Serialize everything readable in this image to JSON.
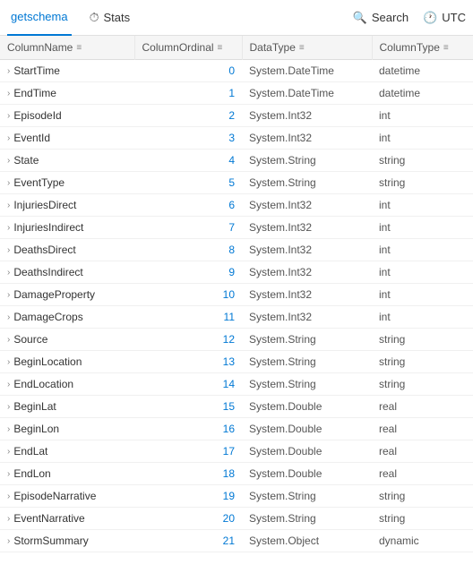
{
  "topbar": {
    "tab_getschema": "getschema",
    "tab_stats": "Stats",
    "search_label": "Search",
    "utc_label": "UTC"
  },
  "table": {
    "headers": [
      {
        "id": "col-name",
        "label": "ColumnName",
        "icon": "≡"
      },
      {
        "id": "col-ordinal",
        "label": "ColumnOrdinal",
        "icon": "≡"
      },
      {
        "id": "col-datatype",
        "label": "DataType",
        "icon": "≡"
      },
      {
        "id": "col-type",
        "label": "ColumnType",
        "icon": "≡"
      }
    ],
    "rows": [
      {
        "name": "StartTime",
        "ordinal": "0",
        "datatype": "System.DateTime",
        "coltype": "datetime"
      },
      {
        "name": "EndTime",
        "ordinal": "1",
        "datatype": "System.DateTime",
        "coltype": "datetime"
      },
      {
        "name": "EpisodeId",
        "ordinal": "2",
        "datatype": "System.Int32",
        "coltype": "int"
      },
      {
        "name": "EventId",
        "ordinal": "3",
        "datatype": "System.Int32",
        "coltype": "int"
      },
      {
        "name": "State",
        "ordinal": "4",
        "datatype": "System.String",
        "coltype": "string"
      },
      {
        "name": "EventType",
        "ordinal": "5",
        "datatype": "System.String",
        "coltype": "string"
      },
      {
        "name": "InjuriesDirect",
        "ordinal": "6",
        "datatype": "System.Int32",
        "coltype": "int"
      },
      {
        "name": "InjuriesIndirect",
        "ordinal": "7",
        "datatype": "System.Int32",
        "coltype": "int"
      },
      {
        "name": "DeathsDirect",
        "ordinal": "8",
        "datatype": "System.Int32",
        "coltype": "int"
      },
      {
        "name": "DeathsIndirect",
        "ordinal": "9",
        "datatype": "System.Int32",
        "coltype": "int"
      },
      {
        "name": "DamageProperty",
        "ordinal": "10",
        "datatype": "System.Int32",
        "coltype": "int"
      },
      {
        "name": "DamageCrops",
        "ordinal": "11",
        "datatype": "System.Int32",
        "coltype": "int"
      },
      {
        "name": "Source",
        "ordinal": "12",
        "datatype": "System.String",
        "coltype": "string"
      },
      {
        "name": "BeginLocation",
        "ordinal": "13",
        "datatype": "System.String",
        "coltype": "string"
      },
      {
        "name": "EndLocation",
        "ordinal": "14",
        "datatype": "System.String",
        "coltype": "string"
      },
      {
        "name": "BeginLat",
        "ordinal": "15",
        "datatype": "System.Double",
        "coltype": "real"
      },
      {
        "name": "BeginLon",
        "ordinal": "16",
        "datatype": "System.Double",
        "coltype": "real"
      },
      {
        "name": "EndLat",
        "ordinal": "17",
        "datatype": "System.Double",
        "coltype": "real"
      },
      {
        "name": "EndLon",
        "ordinal": "18",
        "datatype": "System.Double",
        "coltype": "real"
      },
      {
        "name": "EpisodeNarrative",
        "ordinal": "19",
        "datatype": "System.String",
        "coltype": "string"
      },
      {
        "name": "EventNarrative",
        "ordinal": "20",
        "datatype": "System.String",
        "coltype": "string"
      },
      {
        "name": "StormSummary",
        "ordinal": "21",
        "datatype": "System.Object",
        "coltype": "dynamic"
      }
    ]
  }
}
